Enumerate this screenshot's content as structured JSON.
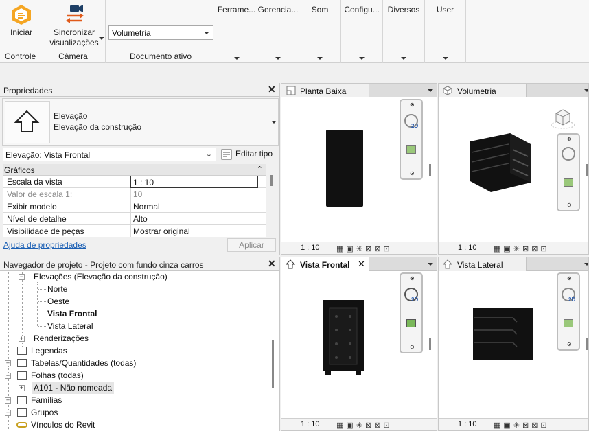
{
  "ribbon": {
    "controle": {
      "button": "Iniciar",
      "group": "Controle"
    },
    "camera": {
      "button_line1": "Sincronizar",
      "button_line2": "visualizações",
      "group": "Câmera"
    },
    "documento": {
      "select_value": "Volumetria",
      "group": "Documento ativo"
    },
    "tabs": [
      "Ferrame...",
      "Gerencia...",
      "Som",
      "Configu...",
      "Diversos",
      "User"
    ]
  },
  "properties": {
    "title": "Propriedades",
    "type_line1": "Elevação",
    "type_line2": "Elevação da construção",
    "selector": "Elevação: Vista Frontal",
    "edit_type": "Editar tipo",
    "group": "Gráficos",
    "rows": [
      {
        "key": "Escala da vista",
        "value": "1 : 10"
      },
      {
        "key": "Valor de escala    1:",
        "value": "10"
      },
      {
        "key": "Exibir modelo",
        "value": "Normal"
      },
      {
        "key": "Nível de detalhe",
        "value": "Alto"
      },
      {
        "key": "Visibilidade de peças",
        "value": "Mostrar original"
      }
    ],
    "help_link": "Ajuda de propriedades",
    "apply": "Aplicar"
  },
  "browser": {
    "title": "Navegador de projeto - Projeto com fundo cinza carros",
    "nodes": {
      "elevacoes": "Elevações (Elevação da construção)",
      "norte": "Norte",
      "oeste": "Oeste",
      "frontal": "Vista Frontal",
      "lateral": "Vista Lateral",
      "render": "Renderizações",
      "legendas": "Legendas",
      "tabelas": "Tabelas/Quantidades (todas)",
      "folhas": "Folhas (todas)",
      "a101": "A101 - Não nomeada",
      "familias": "Famílias",
      "grupos": "Grupos",
      "vinculos": "Vínculos do Revit"
    }
  },
  "views": {
    "planta": {
      "title": "Planta Baixa",
      "scale": "1 : 10"
    },
    "volumetria": {
      "title": "Volumetria",
      "scale": "1 : 10"
    },
    "frontal": {
      "title": "Vista Frontal",
      "scale": "1 : 10"
    },
    "lateral": {
      "title": "Vista Lateral",
      "scale": "1 : 10"
    }
  },
  "colors": {
    "accent_orange": "#f5a623",
    "link": "#1a5fb4",
    "model_black": "#111111"
  }
}
